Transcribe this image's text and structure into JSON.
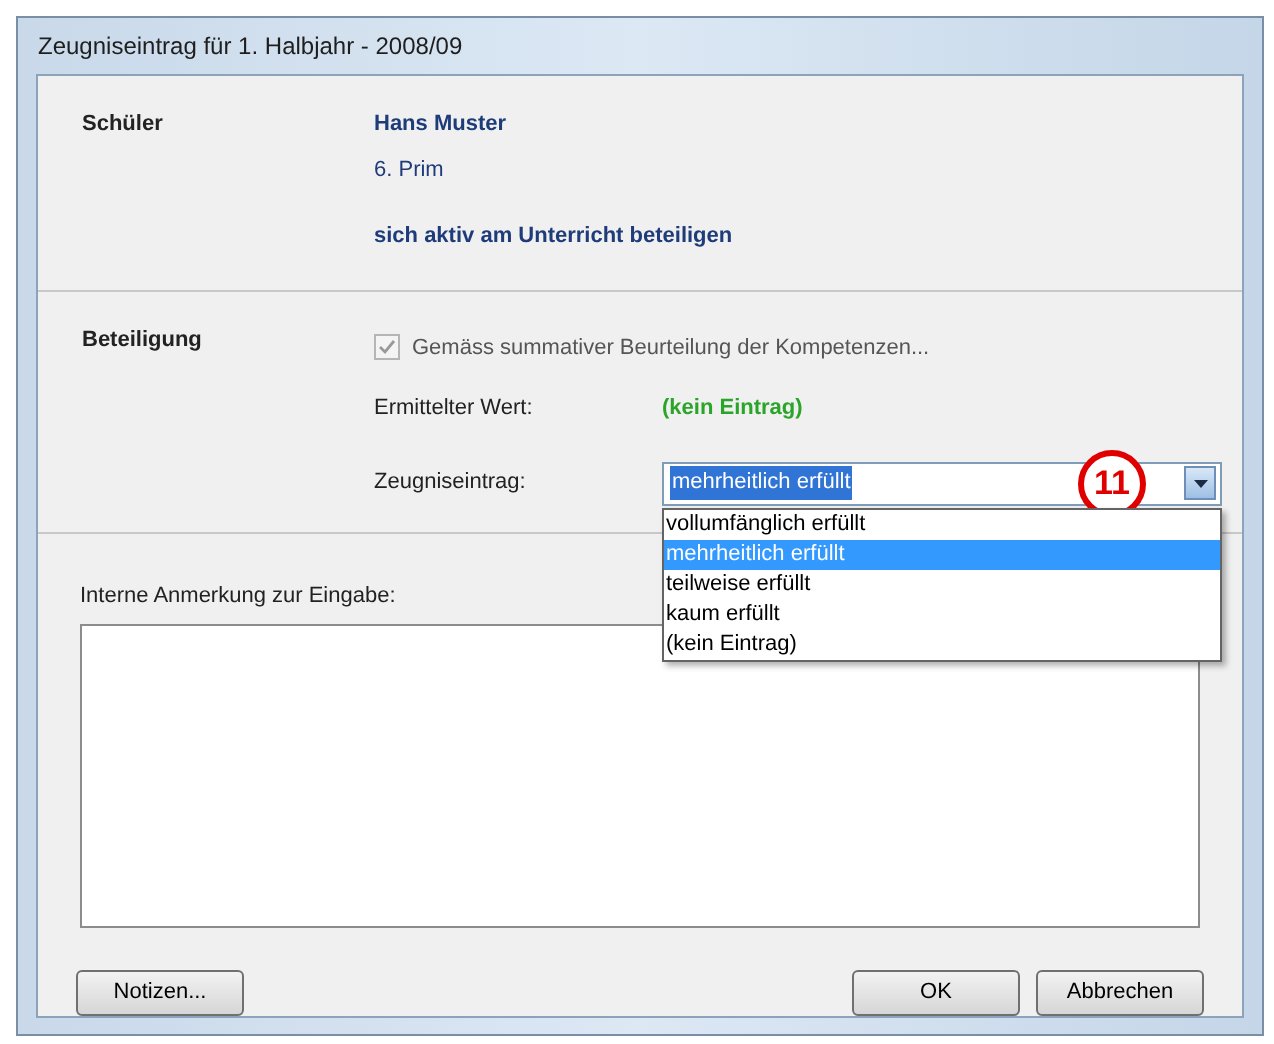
{
  "window": {
    "title": "Zeugniseintrag für 1. Halbjahr - 2008/09"
  },
  "student": {
    "label": "Schüler",
    "name": "Hans Muster",
    "class": "6. Prim",
    "goal": "sich aktiv am Unterricht beteiligen"
  },
  "participation": {
    "label": "Beteiligung",
    "checkbox": {
      "label": "Gemäss summativer Beurteilung der Kompetenzen...",
      "checked": true,
      "disabled": true
    },
    "determined_label": "Ermittelter Wert:",
    "determined_value": "(kein Eintrag)",
    "entry_label": "Zeugniseintrag:",
    "entry_value": "mehrheitlich erfüllt",
    "options": [
      {
        "label": "vollumfänglich erfüllt",
        "selected": false
      },
      {
        "label": "mehrheitlich erfüllt",
        "selected": true
      },
      {
        "label": "teilweise erfüllt",
        "selected": false
      },
      {
        "label": "kaum erfüllt",
        "selected": false
      },
      {
        "label": "(kein Eintrag)",
        "selected": false
      }
    ],
    "marker": "11"
  },
  "note": {
    "label": "Interne Anmerkung zur Eingabe:"
  },
  "buttons": [
    {
      "label": "Notizen...",
      "kind": "left"
    },
    {
      "label": "OK",
      "kind": "right"
    },
    {
      "label": "Abbrechen",
      "kind": "right"
    }
  ]
}
